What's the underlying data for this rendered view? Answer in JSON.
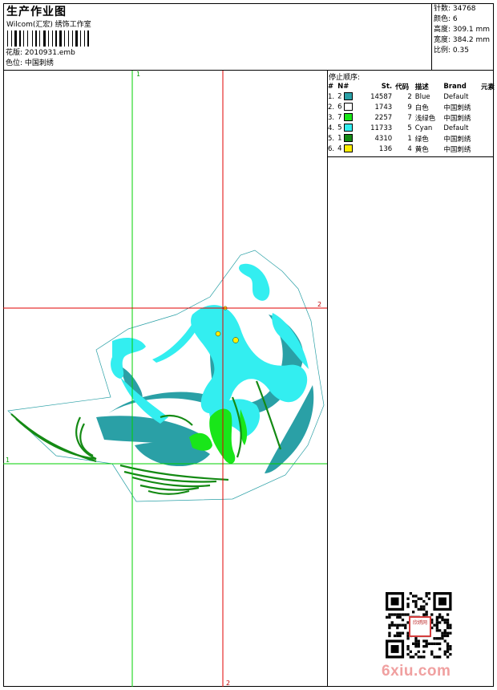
{
  "header": {
    "title": "生产作业图",
    "company": "Wilcom(汇宏) 绣饰工作室"
  },
  "meta": {
    "stitches": "针数: 34768",
    "colors": "颜色: 6",
    "height": "高度: 309.1 mm",
    "width": "宽度: 384.2 mm",
    "scale": "比例: 0.35"
  },
  "design": {
    "file": "花版: 2010931.emb",
    "colorway": "色位: 中国刺绣"
  },
  "stop_sequence": {
    "title": "停止顺序:",
    "headers": [
      "#",
      "N#",
      "St.",
      "代码",
      "描述",
      "Brand",
      "元素"
    ],
    "rows": [
      {
        "num": "1.",
        "n": "2",
        "stitches": "14587",
        "code": "2",
        "desc": "Blue",
        "brand": "Default",
        "color": "#2aa0a6"
      },
      {
        "num": "2.",
        "n": "6",
        "stitches": "1743",
        "code": "9",
        "desc": "白色",
        "brand": "中国刺绣",
        "color": "#ffffff"
      },
      {
        "num": "3.",
        "n": "7",
        "stitches": "2257",
        "code": "7",
        "desc": "浅绿色",
        "brand": "中国刺绣",
        "color": "#19e619"
      },
      {
        "num": "4.",
        "n": "5",
        "stitches": "11733",
        "code": "5",
        "desc": "Cyan",
        "brand": "Default",
        "color": "#33eef0"
      },
      {
        "num": "5.",
        "n": "1",
        "stitches": "4310",
        "code": "1",
        "desc": "绿色",
        "brand": "中国刺绣",
        "color": "#148a14"
      },
      {
        "num": "6.",
        "n": "4",
        "stitches": "136",
        "code": "4",
        "desc": "黄色",
        "brand": "中国刺绣",
        "color": "#ffee00"
      }
    ]
  },
  "guides": {
    "label_1": "1",
    "label_2": "2"
  },
  "watermark": {
    "text": "6xiu.com",
    "stamp": "欣绣网"
  }
}
